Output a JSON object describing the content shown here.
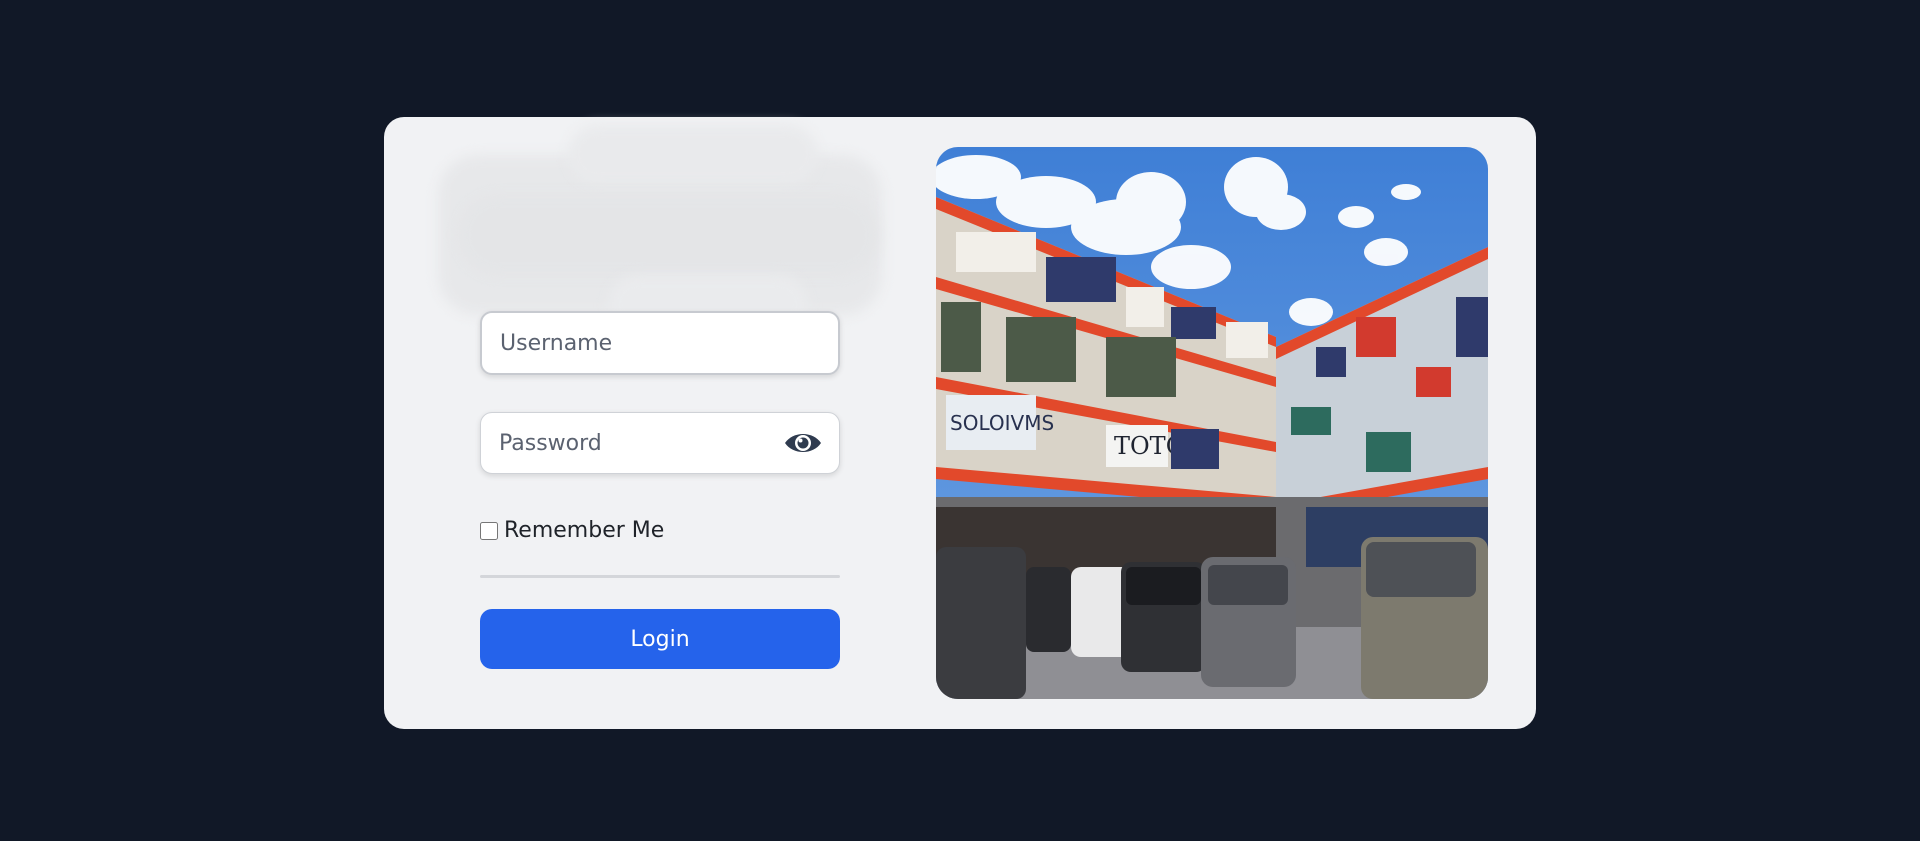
{
  "login": {
    "username_placeholder": "Username",
    "password_placeholder": "Password",
    "remember_label": "Remember Me",
    "login_label": "Login",
    "show_password_icon": "eye-icon"
  },
  "photo": {
    "signs": [
      "TOTO",
      "SOLOIVMS"
    ]
  },
  "colors": {
    "background": "#111827",
    "card": "#f1f2f4",
    "accent": "#2563eb"
  }
}
